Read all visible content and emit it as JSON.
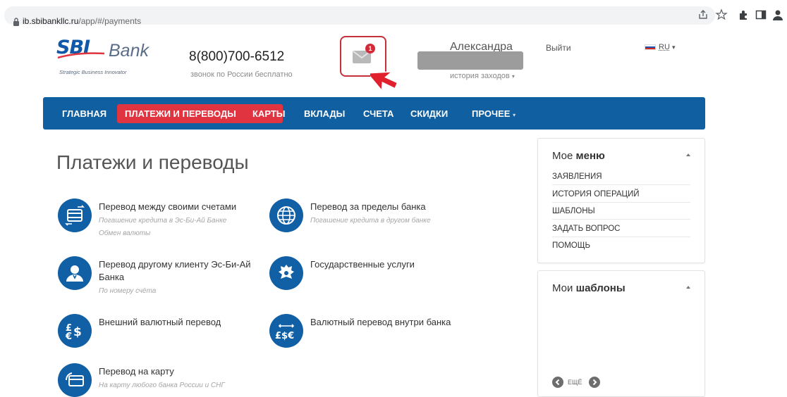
{
  "browser": {
    "url_host": "ib.sbibankllc.ru",
    "url_path": "/app/#/payments"
  },
  "header": {
    "logo_main": "SBI",
    "logo_bank": "Bank",
    "logo_tagline": "Strategic Business Innovator",
    "phone": "8(800)700-6512",
    "phone_note": "звонок по России бесплатно",
    "mail_count": "1",
    "user_name": "Александра",
    "history_link": "история заходов",
    "logout": "Выйти",
    "language": "RU"
  },
  "nav": {
    "items": [
      "ГЛАВНАЯ",
      "ПЛАТЕЖИ И ПЕРЕВОДЫ",
      "КАРТЫ",
      "ВКЛАДЫ",
      "СЧЕТА",
      "СКИДКИ",
      "ПРОЧЕЕ"
    ]
  },
  "main": {
    "title": "Платежи и переводы",
    "services": [
      {
        "title": "Перевод между своими счетами",
        "sub1": "Погашение кредита в Эс-Би-Ай Банке",
        "sub2": "Обмен валюты",
        "icon": "transfer-own-accounts-icon"
      },
      {
        "title": "Перевод за пределы банка",
        "sub1": "Погашение кредита в другом банке",
        "icon": "globe-icon"
      },
      {
        "title": "Перевод другому клиенту Эс-Би-Ай",
        "title2": "Банка",
        "sub1": "По номеру счёта",
        "icon": "person-icon"
      },
      {
        "title": "Государственные услуги",
        "icon": "coat-of-arms-icon"
      },
      {
        "title": "Внешний валютный перевод",
        "icon": "currency-exchange-icon"
      },
      {
        "title": "Валютный перевод внутри банка",
        "icon": "currency-internal-icon"
      },
      {
        "title": "Перевод на карту",
        "sub1": "На карту любого банка России и СНГ",
        "icon": "card-transfer-icon"
      }
    ]
  },
  "sidebar": {
    "menu_title_light": "Мое",
    "menu_title_bold": "меню",
    "menu_items": [
      "ЗАЯВЛЕНИЯ",
      "ИСТОРИЯ ОПЕРАЦИЙ",
      "ШАБЛОНЫ",
      "ЗАДАТЬ ВОПРОС",
      "ПОМОЩЬ"
    ],
    "templates_title_light": "Мои",
    "templates_title_bold": "шаблоны",
    "more_label": "ЕЩЁ"
  },
  "colors": {
    "brand_blue": "#0f5fa1",
    "accent_red": "#e03440"
  }
}
